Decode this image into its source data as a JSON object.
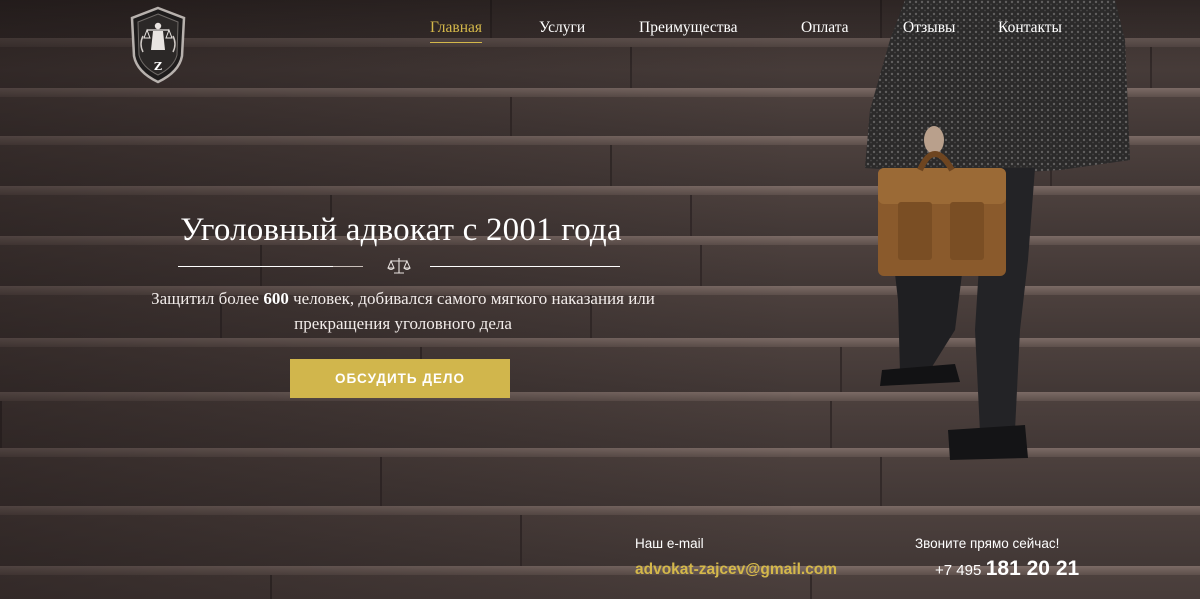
{
  "brand": {
    "logo_letter": "Z"
  },
  "nav": {
    "items": [
      {
        "label": "Главная",
        "active": true
      },
      {
        "label": "Услуги",
        "active": false
      },
      {
        "label": "Преимущества",
        "active": false
      },
      {
        "label": "Оплата",
        "active": false
      },
      {
        "label": "Отзывы",
        "active": false
      },
      {
        "label": "Контакты",
        "active": false
      }
    ]
  },
  "hero": {
    "title": "Уголовный адвокат с 2001 года",
    "divider_icon": "scales-icon",
    "subtitle_before": "Защитил более ",
    "subtitle_bold": "600",
    "subtitle_after": " человек, добивался самого мягкого наказания или прекращения уголовного дела",
    "cta_label": "ОБСУДИТЬ ДЕЛО"
  },
  "contacts": {
    "email_label": "Наш e-mail",
    "email": "advokat-zajcev@gmail.com",
    "phone_label": "Звоните прямо сейчас!",
    "phone_prefix": "+7 495",
    "phone_number": "181 20 21"
  },
  "colors": {
    "accent": "#d1b64c",
    "text": "#ffffff"
  }
}
